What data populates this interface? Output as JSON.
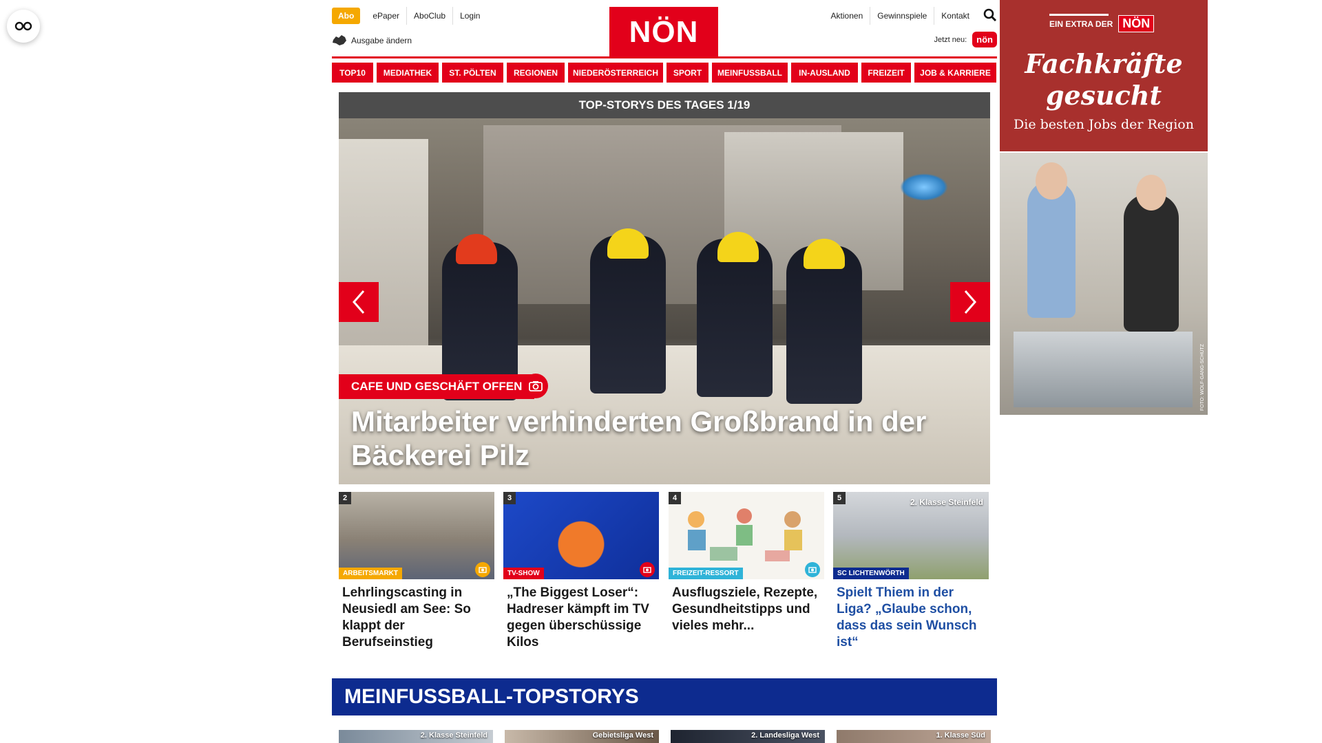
{
  "topbar": {
    "abo": "Abo",
    "left_links": [
      "ePaper",
      "AboClub",
      "Login"
    ],
    "ausgabe": "Ausgabe ändern",
    "logo": "NÖN",
    "right_links": [
      "Aktionen",
      "Gewinnspiele",
      "Kontakt"
    ],
    "jetzt_neu": "Jetzt neu:",
    "jetzt_badge": "nön"
  },
  "nav": {
    "items": [
      "TOP10",
      "MEDIATHEK",
      "ST. PÖLTEN",
      "REGIONEN",
      "NIEDERÖSTERREICH",
      "SPORT",
      "MEINFUSSBALL",
      "IN-AUSLAND",
      "FREIZEIT",
      "JOB & KARRIERE"
    ]
  },
  "hero": {
    "bar": "TOP-STORYS DES TAGES 1/19",
    "tag": "CAFE UND GESCHÄFT OFFEN",
    "title": "Mitarbeiter verhinderten Großbrand in der Bäckerei Pilz"
  },
  "cards": [
    {
      "num": "2",
      "category": "ARBEITSMARKT",
      "title": "Lehrlingscasting in Neusiedl am See: So klappt der Berufseinstieg",
      "cat_color": "#f5a800"
    },
    {
      "num": "3",
      "category": "TV-SHOW",
      "title": "„The Biggest Loser“: Hadreser kämpft im TV gegen überschüssige Kilos",
      "cat_color": "#e2001a"
    },
    {
      "num": "4",
      "category": "FREIZEIT-RESSORT",
      "title": "Ausflugsziele, Rezepte, Gesundheitstipps und vieles mehr...",
      "cat_color": "#2fb3d8"
    },
    {
      "num": "5",
      "category": "SC LICHTENWÖRTH",
      "title": "Spielt Thiem in der Liga? „Glaube schon, dass das sein Wunsch ist“",
      "cat_color": "#0d2b8f",
      "overlay": "2. Klasse Steinfeld"
    }
  ],
  "section": {
    "title": "MEINFUSSBALL-TOPSTORYS",
    "minis": [
      "2. Klasse Steinfeld",
      "Gebietsliga West",
      "2. Landesliga West",
      "1. Klasse Süd"
    ]
  },
  "ad": {
    "extra": "EIN EXTRA DER",
    "logo": "NÖN",
    "headline_1": "Fachkräfte",
    "headline_2": "gesucht",
    "sub": "Die besten Jobs der Region",
    "credit": "FOTO: WOLF-GANG-SCHÜTZ"
  }
}
